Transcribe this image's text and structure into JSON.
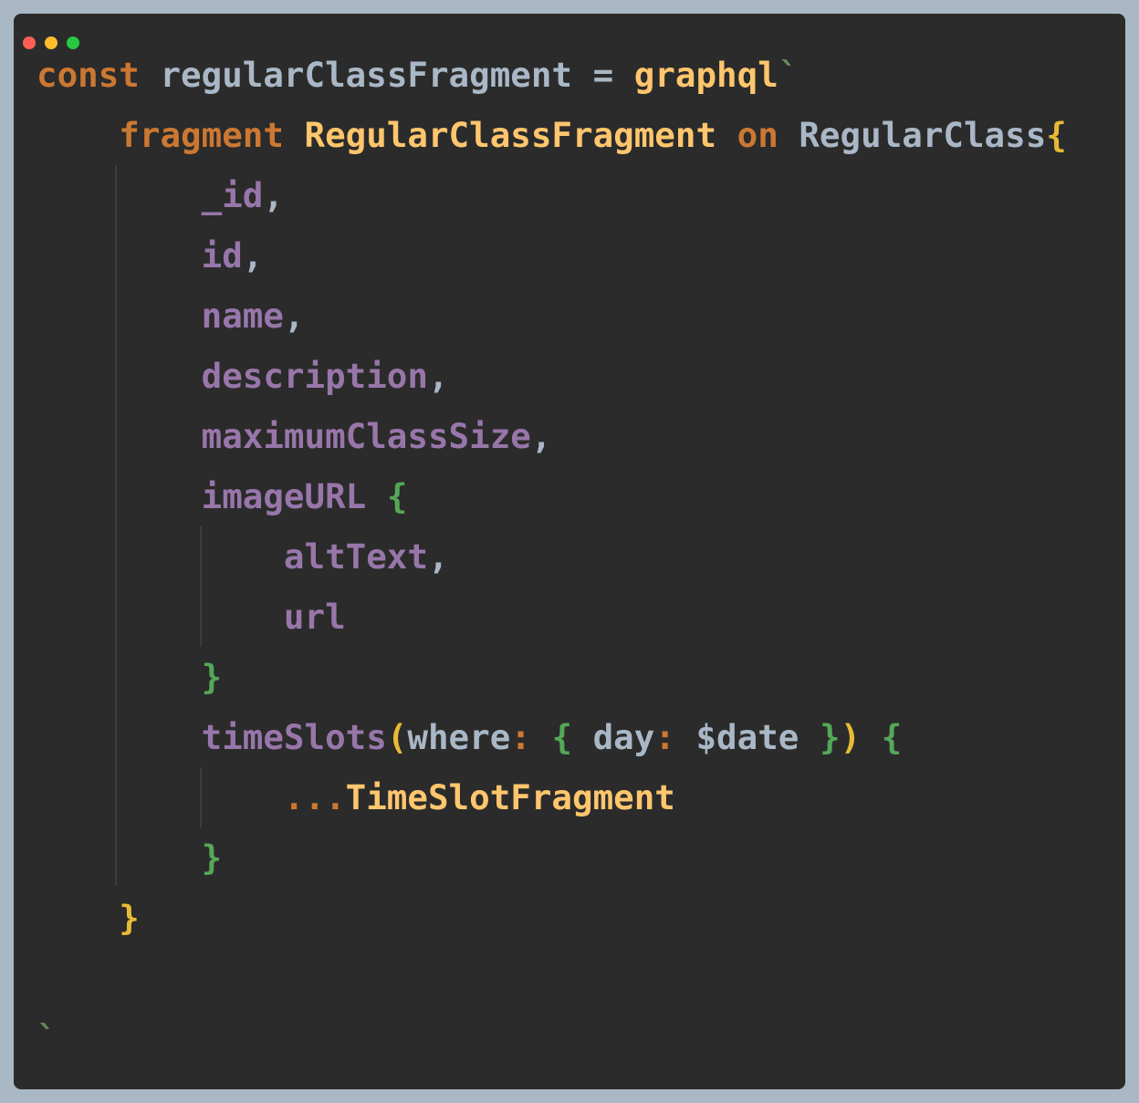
{
  "window": {
    "traffic_lights": [
      {
        "name": "close",
        "color": "#ff5f56"
      },
      {
        "name": "minimize",
        "color": "#ffbd2e"
      },
      {
        "name": "zoom",
        "color": "#27c93f"
      }
    ]
  },
  "colors": {
    "background": "#2b2b2b",
    "frame": "#aab7c5",
    "keyword": "#cc7832",
    "identifier": "#a9b7c6",
    "function": "#ffc66d",
    "field": "#9876aa",
    "brace_yellow": "#e8ba36",
    "brace_green": "#54a857",
    "backtick": "#6a8759"
  },
  "code_lines": [
    {
      "tokens": [
        {
          "text": "const ",
          "color": "#cc7832"
        },
        {
          "text": "regularClassFragment = ",
          "color": "#a9b7c6"
        },
        {
          "text": "graphql",
          "color": "#ffc66d"
        },
        {
          "text": "`",
          "color": "#6a8759"
        }
      ]
    },
    {
      "tokens": [
        {
          "text": "    fragment ",
          "color": "#cc7832"
        },
        {
          "text": "RegularClassFragment ",
          "color": "#ffc66d"
        },
        {
          "text": "on ",
          "color": "#cc7832"
        },
        {
          "text": "RegularClass",
          "color": "#a9b7c6"
        },
        {
          "text": "{",
          "color": "#e8ba36"
        }
      ]
    },
    {
      "tokens": [
        {
          "text": "        _id",
          "color": "#9876aa"
        },
        {
          "text": ",",
          "color": "#a9b7c6"
        }
      ]
    },
    {
      "tokens": [
        {
          "text": "        id",
          "color": "#9876aa"
        },
        {
          "text": ",",
          "color": "#a9b7c6"
        }
      ]
    },
    {
      "tokens": [
        {
          "text": "        name",
          "color": "#9876aa"
        },
        {
          "text": ",",
          "color": "#a9b7c6"
        }
      ]
    },
    {
      "tokens": [
        {
          "text": "        description",
          "color": "#9876aa"
        },
        {
          "text": ",",
          "color": "#a9b7c6"
        }
      ]
    },
    {
      "tokens": [
        {
          "text": "        maximumClassSize",
          "color": "#9876aa"
        },
        {
          "text": ",",
          "color": "#a9b7c6"
        }
      ]
    },
    {
      "tokens": [
        {
          "text": "        imageURL ",
          "color": "#9876aa"
        },
        {
          "text": "{",
          "color": "#54a857"
        }
      ]
    },
    {
      "tokens": [
        {
          "text": "            altText",
          "color": "#9876aa"
        },
        {
          "text": ",",
          "color": "#a9b7c6"
        }
      ]
    },
    {
      "tokens": [
        {
          "text": "            url",
          "color": "#9876aa"
        }
      ]
    },
    {
      "tokens": [
        {
          "text": "        }",
          "color": "#54a857"
        }
      ]
    },
    {
      "tokens": [
        {
          "text": "        timeSlots",
          "color": "#9876aa"
        },
        {
          "text": "(",
          "color": "#e8ba36"
        },
        {
          "text": "where",
          "color": "#a9b7c6"
        },
        {
          "text": ": ",
          "color": "#cc7832"
        },
        {
          "text": "{ ",
          "color": "#54a857"
        },
        {
          "text": "day",
          "color": "#a9b7c6"
        },
        {
          "text": ": ",
          "color": "#cc7832"
        },
        {
          "text": "$date ",
          "color": "#a9b7c6"
        },
        {
          "text": "}",
          "color": "#54a857"
        },
        {
          "text": ") ",
          "color": "#e8ba36"
        },
        {
          "text": "{",
          "color": "#54a857"
        }
      ]
    },
    {
      "tokens": [
        {
          "text": "            ...",
          "color": "#cc7832"
        },
        {
          "text": "TimeSlotFragment",
          "color": "#ffc66d"
        }
      ]
    },
    {
      "tokens": [
        {
          "text": "        }",
          "color": "#54a857"
        }
      ]
    },
    {
      "tokens": [
        {
          "text": "    }",
          "color": "#e8ba36"
        }
      ]
    },
    {
      "tokens": []
    },
    {
      "tokens": [
        {
          "text": "`",
          "color": "#6a8759"
        }
      ]
    }
  ]
}
